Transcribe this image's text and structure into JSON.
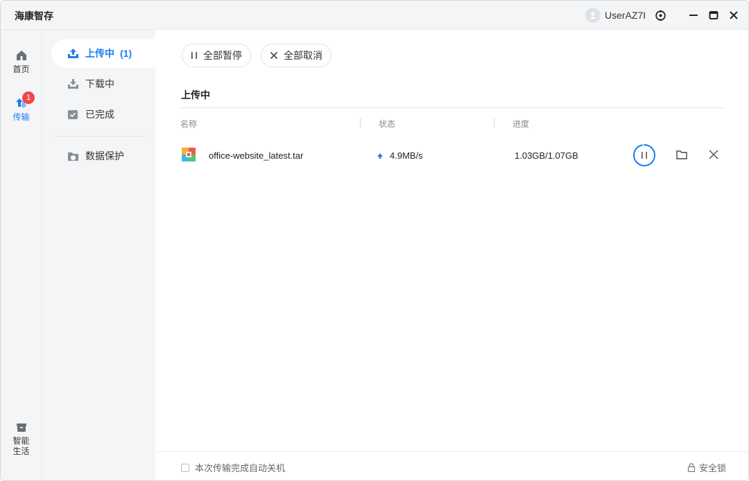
{
  "app": {
    "title": "海康智存"
  },
  "user": {
    "name": "UserAZ7I"
  },
  "rail": {
    "items": [
      {
        "label": "首页",
        "icon": "home-icon"
      },
      {
        "label": "传输",
        "icon": "transfer-icon",
        "badge": "1"
      },
      {
        "label": "智能\n生活",
        "label_line1": "智能",
        "label_line2": "生活",
        "icon": "smart-life-icon"
      }
    ]
  },
  "subnav": {
    "items": [
      {
        "label": "上传中",
        "count": "(1)",
        "icon": "upload-icon"
      },
      {
        "label": "下载中",
        "icon": "download-icon"
      },
      {
        "label": "已完成",
        "icon": "completed-icon"
      },
      {
        "label": "数据保护",
        "icon": "data-protect-icon"
      }
    ]
  },
  "toolbar": {
    "pause_all": "全部暂停",
    "cancel_all": "全部取消"
  },
  "section": {
    "title": "上传中"
  },
  "table": {
    "columns": [
      "名称",
      "状态",
      "进度"
    ],
    "rows": [
      {
        "name": "office-website_latest.tar",
        "speed": "4.9MB/s",
        "progress": "1.03GB/1.07GB",
        "progress_fraction": 0.963
      }
    ]
  },
  "footer": {
    "auto_shutdown": "本次传输完成自动关机",
    "safe_lock": "安全锁"
  },
  "colors": {
    "accent": "#1a7cf0",
    "badge": "#f0494b"
  }
}
